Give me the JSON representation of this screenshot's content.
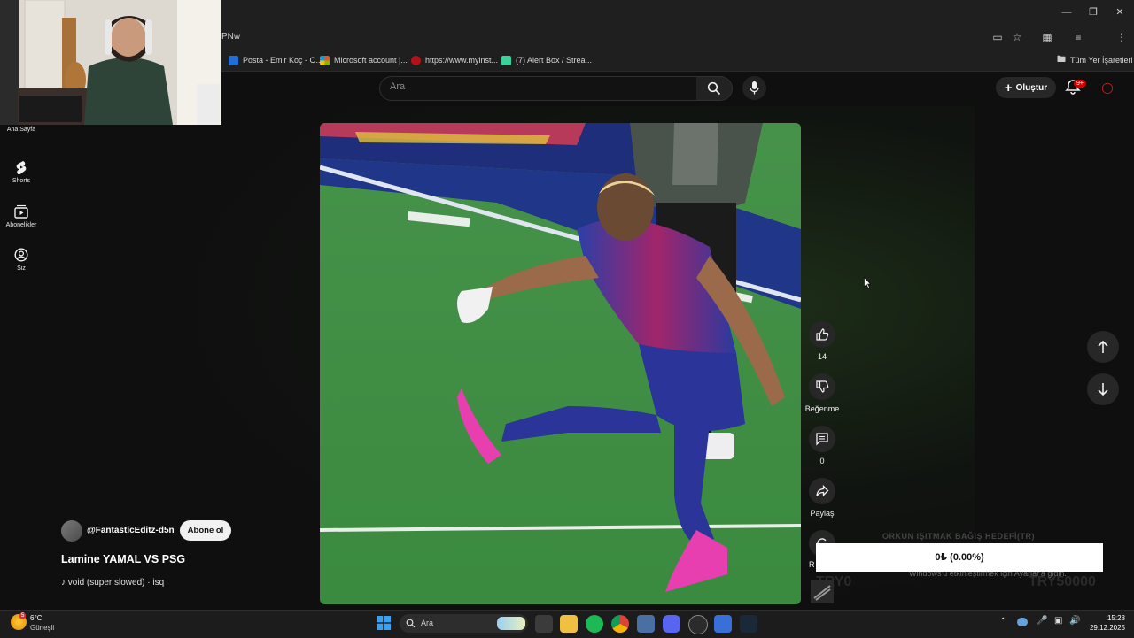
{
  "browser": {
    "url_fragment": "PNw",
    "bookmarks": [
      {
        "label": "Posta - Emir Koç - O...",
        "icon_color": "#1e6fd8"
      },
      {
        "label": "Microsoft account |...",
        "icon_color": "#f25022"
      },
      {
        "label": "https://www.myinst...",
        "icon_color": "#b3121a"
      },
      {
        "label": "(7) Alert Box / Strea...",
        "icon_color": "#3ad19b"
      }
    ],
    "all_bookmarks_label": "Tüm Yer İşaretleri"
  },
  "youtube": {
    "search_placeholder": "Ara",
    "create_label": "Oluştur",
    "notification_count": "9+",
    "sidebar": [
      {
        "label": "Ana Sayfa",
        "icon": "home-icon"
      },
      {
        "label": "Shorts",
        "icon": "shorts-icon"
      },
      {
        "label": "Abonelikler",
        "icon": "subscriptions-icon"
      },
      {
        "label": "Siz",
        "icon": "profile-icon"
      }
    ],
    "actions": {
      "like_count": "14",
      "dislike_label": "Beğenme",
      "comment_count": "0",
      "share_label": "Paylaş",
      "remix_label": "R"
    },
    "channel": {
      "handle": "@FantasticEditz-d5n",
      "subscribe_label": "Abone ol"
    },
    "video_title": "Lamine YAMAL VS PSG",
    "music": "void (super slowed) · isq"
  },
  "stream_overlay": {
    "title": "ORKUN IŞITMAK BAĞIŞ HEDEFİ(TR)",
    "progress_text": "0₺ (0.00%)",
    "left_amount": "TRY0",
    "right_amount": "TRY50000",
    "windows_activation": "Windows'u etkinleştirmek için Ayarlar'a gidin."
  },
  "taskbar": {
    "weather_temp": "6°C",
    "weather_desc": "Güneşli",
    "weather_badge": "5",
    "search_placeholder": "Ara",
    "time": "15:28",
    "date": "29.12.2025"
  }
}
